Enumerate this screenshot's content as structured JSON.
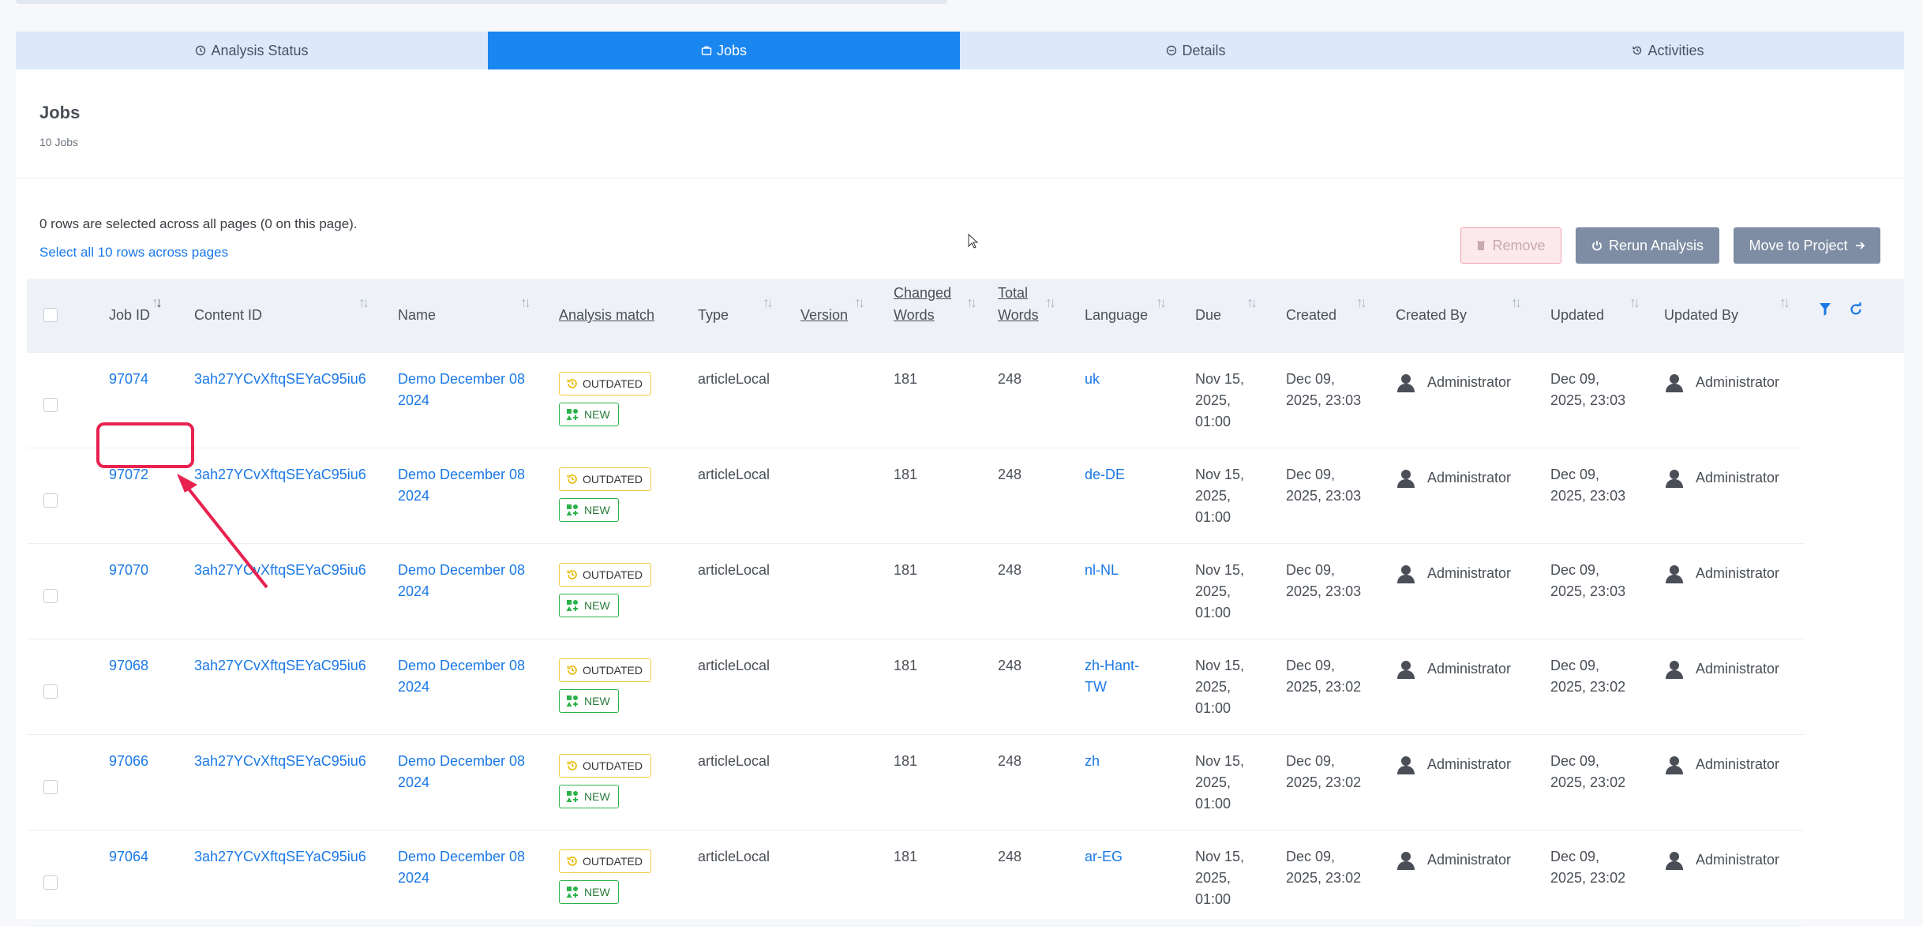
{
  "tabs": [
    {
      "label": "Analysis Status",
      "icon": "clock-icon",
      "active": false
    },
    {
      "label": "Jobs",
      "icon": "briefcase-icon",
      "active": true
    },
    {
      "label": "Details",
      "icon": "minus-circle-icon",
      "active": false
    },
    {
      "label": "Activities",
      "icon": "history-icon",
      "active": false
    }
  ],
  "header": {
    "title": "Jobs",
    "count": "10 Jobs"
  },
  "selection": {
    "info": "0 rows are selected across all pages (0 on this page).",
    "select_all": "Select all 10 rows across pages"
  },
  "buttons": {
    "remove": "Remove",
    "rerun": "Rerun Analysis",
    "move": "Move to Project"
  },
  "columns": {
    "job_id": "Job ID",
    "content_id": "Content ID",
    "name": "Name",
    "analysis_match": "Analysis match",
    "type": "Type",
    "version": "Version",
    "changed_words_1": "Changed",
    "changed_words_2": "Words",
    "total_words_1": "Total",
    "total_words_2": "Words",
    "language": "Language",
    "due": "Due",
    "created": "Created",
    "created_by": "Created By",
    "updated": "Updated",
    "updated_by": "Updated By"
  },
  "badges": {
    "outdated": "OUTDATED",
    "new": "NEW"
  },
  "rows": [
    {
      "job_id": "97074",
      "content_id": "3ah27YCvXftqSEYaC95iu6",
      "name_1": "Demo December 08",
      "name_2": "2024",
      "type": "articleLocal",
      "changed": "181",
      "total": "248",
      "lang_1": "uk",
      "lang_2": "",
      "due_1": "Nov 15,",
      "due_2": "2025,",
      "due_3": "01:00",
      "created_1": "Dec 09,",
      "created_2": "2025, 23:03",
      "created_by": "Administrator",
      "updated_1": "Dec 09,",
      "updated_2": "2025, 23:03",
      "updated_by": "Administrator"
    },
    {
      "job_id": "97072",
      "content_id": "3ah27YCvXftqSEYaC95iu6",
      "name_1": "Demo December 08",
      "name_2": "2024",
      "type": "articleLocal",
      "changed": "181",
      "total": "248",
      "lang_1": "de-DE",
      "lang_2": "",
      "due_1": "Nov 15,",
      "due_2": "2025,",
      "due_3": "01:00",
      "created_1": "Dec 09,",
      "created_2": "2025, 23:03",
      "created_by": "Administrator",
      "updated_1": "Dec 09,",
      "updated_2": "2025, 23:03",
      "updated_by": "Administrator"
    },
    {
      "job_id": "97070",
      "content_id": "3ah27YCvXftqSEYaC95iu6",
      "name_1": "Demo December 08",
      "name_2": "2024",
      "type": "articleLocal",
      "changed": "181",
      "total": "248",
      "lang_1": "nl-NL",
      "lang_2": "",
      "due_1": "Nov 15,",
      "due_2": "2025,",
      "due_3": "01:00",
      "created_1": "Dec 09,",
      "created_2": "2025, 23:03",
      "created_by": "Administrator",
      "updated_1": "Dec 09,",
      "updated_2": "2025, 23:03",
      "updated_by": "Administrator"
    },
    {
      "job_id": "97068",
      "content_id": "3ah27YCvXftqSEYaC95iu6",
      "name_1": "Demo December 08",
      "name_2": "2024",
      "type": "articleLocal",
      "changed": "181",
      "total": "248",
      "lang_1": "zh-Hant-",
      "lang_2": "TW",
      "due_1": "Nov 15,",
      "due_2": "2025,",
      "due_3": "01:00",
      "created_1": "Dec 09,",
      "created_2": "2025, 23:02",
      "created_by": "Administrator",
      "updated_1": "Dec 09,",
      "updated_2": "2025, 23:02",
      "updated_by": "Administrator"
    },
    {
      "job_id": "97066",
      "content_id": "3ah27YCvXftqSEYaC95iu6",
      "name_1": "Demo December 08",
      "name_2": "2024",
      "type": "articleLocal",
      "changed": "181",
      "total": "248",
      "lang_1": "zh",
      "lang_2": "",
      "due_1": "Nov 15,",
      "due_2": "2025,",
      "due_3": "01:00",
      "created_1": "Dec 09,",
      "created_2": "2025, 23:02",
      "created_by": "Administrator",
      "updated_1": "Dec 09,",
      "updated_2": "2025, 23:02",
      "updated_by": "Administrator"
    },
    {
      "job_id": "97064",
      "content_id": "3ah27YCvXftqSEYaC95iu6",
      "name_1": "Demo December 08",
      "name_2": "2024",
      "type": "articleLocal",
      "changed": "181",
      "total": "248",
      "lang_1": "ar-EG",
      "lang_2": "",
      "due_1": "Nov 15,",
      "due_2": "2025,",
      "due_3": "01:00",
      "created_1": "Dec 09,",
      "created_2": "2025, 23:02",
      "created_by": "Administrator",
      "updated_1": "Dec 09,",
      "updated_2": "2025, 23:02",
      "updated_by": "Administrator"
    }
  ]
}
